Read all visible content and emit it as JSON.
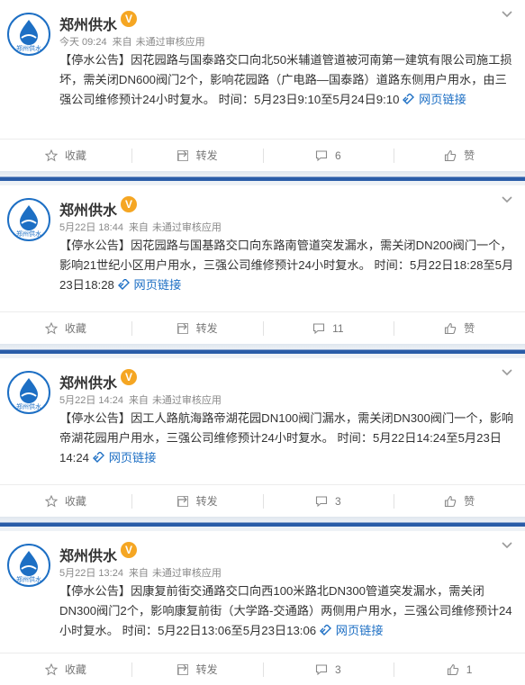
{
  "account": {
    "name": "郑州供水",
    "verified": "V"
  },
  "posts": [
    {
      "time": "今天 09:24",
      "source": "来自",
      "status": "未通过审核应用",
      "text": "【停水公告】因花园路与国泰路交口向北50米辅道管道被河南第一建筑有限公司施工损坏，需关闭DN600阀门2个，影响花园路（广电路—国泰路）道路东侧用户用水，由三强公司维修预计24小时复水。 时间：5月23日9:10至5月24日9:10",
      "link": "网页链接",
      "collect": "收藏",
      "repost": "转发",
      "comments": "6",
      "likes": "赞"
    },
    {
      "time": "5月22日 18:44",
      "source": "来自",
      "status": "未通过审核应用",
      "text": "【停水公告】因花园路与国基路交口向东路南管道突发漏水，需关闭DN200阀门一个，影响21世纪小区用户用水，三强公司维修预计24小时复水。 时间：5月22日18:28至5月23日18:28",
      "link": "网页链接",
      "collect": "收藏",
      "repost": "转发",
      "comments": "11",
      "likes": "赞"
    },
    {
      "time": "5月22日 14:24",
      "source": "来自",
      "status": "未通过审核应用",
      "text": "【停水公告】因工人路航海路帝湖花园DN100阀门漏水，需关闭DN300阀门一个，影响帝湖花园用户用水，三强公司维修预计24小时复水。 时间：5月22日14:24至5月23日14:24",
      "link": "网页链接",
      "collect": "收藏",
      "repost": "转发",
      "comments": "3",
      "likes": "赞"
    },
    {
      "time": "5月22日 13:24",
      "source": "来自",
      "status": "未通过审核应用",
      "text": "【停水公告】因康复前街交通路交口向西100米路北DN300管道突发漏水，需关闭DN300阀门2个，影响康复前街（大学路-交通路）两侧用户用水，三强公司维修预计24小时复水。 时间：5月22日13:06至5月23日13:06",
      "link": "网页链接",
      "collect": "收藏",
      "repost": "转发",
      "comments": "3",
      "likes": "1"
    }
  ],
  "colors": {
    "brand": "#1d6fc4",
    "badge": "#f5a623",
    "separator": "#2a5da8"
  },
  "icons": {
    "avatar": "water-drop-logo",
    "more": "chevron-down-icon",
    "collect": "star-icon",
    "repost": "repost-icon",
    "comment": "comment-icon",
    "like": "thumbs-up-icon",
    "link": "link-icon"
  }
}
